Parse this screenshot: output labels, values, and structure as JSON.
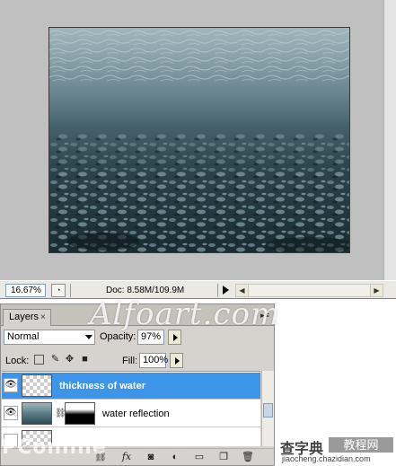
{
  "statusbar": {
    "zoom": "16.67%",
    "doc_size": "Doc: 8.58M/109.9M"
  },
  "layers_panel": {
    "tab_label": "Layers",
    "tab_close": "×",
    "blend_mode": "Normal",
    "opacity_label": "Opacity:",
    "opacity_value": "97%",
    "lock_label": "Lock:",
    "fill_label": "Fill:",
    "fill_value": "100%",
    "layers": [
      {
        "name": "thickness of water",
        "visible": true,
        "selected": true
      },
      {
        "name": "water reflection",
        "visible": true,
        "selected": false
      }
    ]
  },
  "watermarks": {
    "site": "Alfoart.com",
    "pconline": "PConline",
    "chazidian_main": "查字典",
    "chazidian_badge": "教程网",
    "chazidian_url": "jiaocheng.chazidian.com"
  },
  "colors": {
    "selection": "#3d95ea",
    "panel_bg": "#d6d3ce",
    "canvas_bg": "#c0c0c0"
  }
}
